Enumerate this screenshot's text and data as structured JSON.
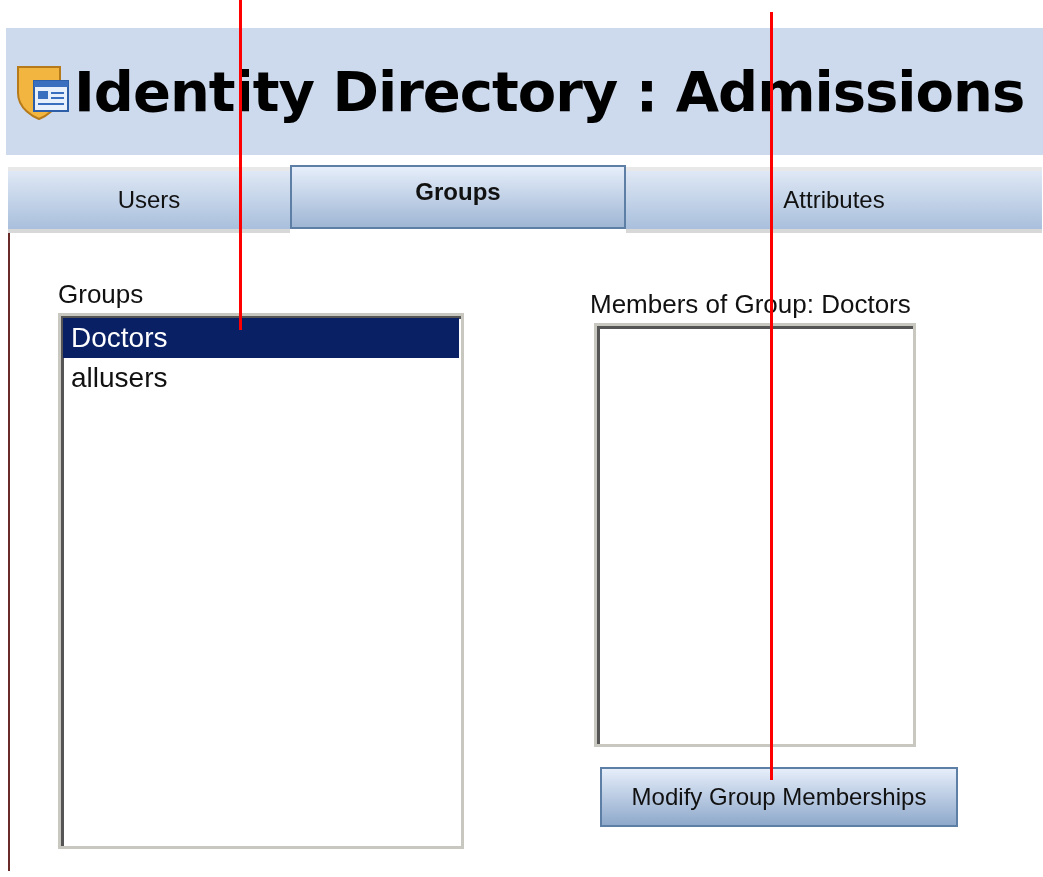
{
  "header": {
    "title": "Identity Directory : Admissions"
  },
  "tabs": [
    {
      "label": "Users",
      "selected": false
    },
    {
      "label": "Groups",
      "selected": true
    },
    {
      "label": "Attributes",
      "selected": false
    }
  ],
  "groups": {
    "label": "Groups",
    "items": [
      {
        "label": "Doctors",
        "selected": true
      },
      {
        "label": "allusers",
        "selected": false
      }
    ]
  },
  "members": {
    "label": "Members of Group: Doctors"
  },
  "buttons": [
    "Modify Group Memberships"
  ]
}
